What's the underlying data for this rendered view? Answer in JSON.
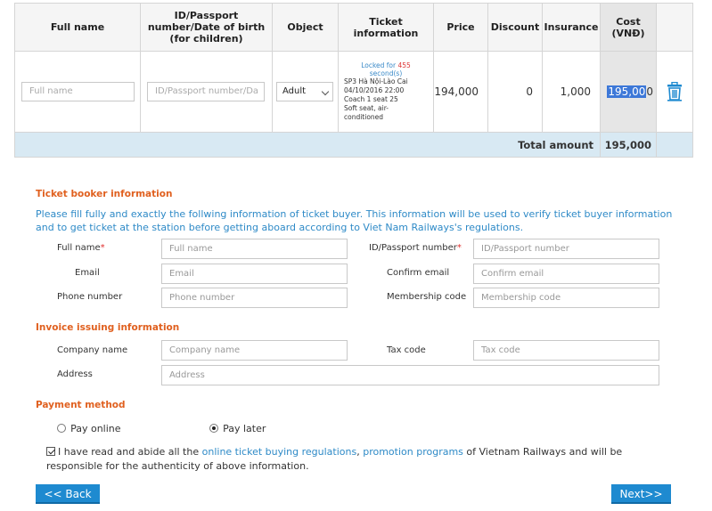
{
  "table": {
    "headers": {
      "full_name": "Full name",
      "id_line1": "ID/Passport",
      "id_line2": "number/Date of birth",
      "id_line3": "(for children)",
      "object": "Object",
      "ticket_line1": "Ticket",
      "ticket_line2": "information",
      "price": "Price",
      "discount": "Discount",
      "insurance": "Insurance",
      "cost_line1": "Cost",
      "cost_line2": "(VNĐ)"
    },
    "row": {
      "full_name_placeholder": "Full name",
      "id_placeholder": "ID/Passport number/Da",
      "object_value": "Adult",
      "lock_text1": "Locked for",
      "lock_seconds": "455",
      "lock_text2": "second(s)",
      "train": "SP3 Hà Nội-Lào Cai",
      "datetime": "04/10/2016 22:00",
      "coach_seat": "Coach 1 seat 25",
      "seat_type1": "Soft seat, air-",
      "seat_type2": "conditioned",
      "price": "194,000",
      "discount": "0",
      "insurance": "1,000",
      "cost_selected": "195,00",
      "cost_rest": "0",
      "delete_icon": "trash-icon"
    },
    "total_label": "Total amount",
    "total_value": "195,000"
  },
  "booker": {
    "title": "Ticket booker information",
    "description": "Please fill fully and exactly the follwing information of ticket buyer. This information will be used to verify ticket buyer information and to get ticket at the station before getting aboard according to Viet Nam Railways's regulations.",
    "full_name_label": "Full name",
    "required_mark": "*",
    "full_name_placeholder": "Full name",
    "id_label": "ID/Passport number",
    "id_placeholder": "ID/Passport number",
    "email_label": "Email",
    "email_placeholder": "Email",
    "confirm_email_label": "Confirm email",
    "confirm_email_placeholder": "Confirm email",
    "phone_label": "Phone number",
    "phone_placeholder": "Phone number",
    "membership_label": "Membership code",
    "membership_placeholder": "Membership code"
  },
  "invoice": {
    "title": "Invoice issuing information",
    "company_label": "Company name",
    "company_placeholder": "Company name",
    "tax_label": "Tax code",
    "tax_placeholder": "Tax code",
    "address_label": "Address",
    "address_placeholder": "Address"
  },
  "payment": {
    "title": "Payment method",
    "online": "Pay online",
    "later": "Pay later",
    "selected": "Pay later"
  },
  "agreement": {
    "text1": "I have read and abide all the",
    "link1": "online ticket buying regulations",
    "comma": ",",
    "link2": "promotion programs",
    "text2": "of Vietnam Railways and will be responsible for the authenticity of above information."
  },
  "buttons": {
    "back": "<< Back",
    "next": "Next>>"
  },
  "colors": {
    "accent_blue": "#1e8ad0",
    "section_orange": "#e0601f",
    "text_blue": "#2e8ac7",
    "total_row_bg": "#d8e9f3"
  }
}
